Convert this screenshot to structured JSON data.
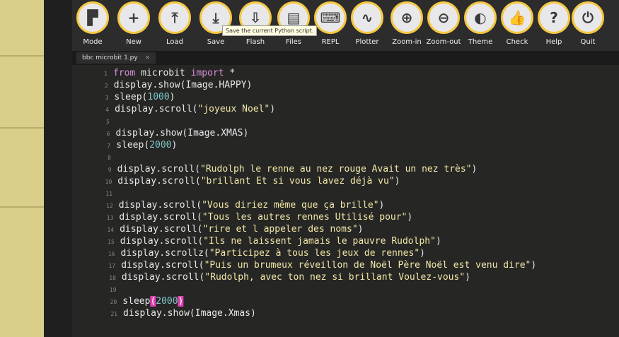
{
  "toolbar": {
    "buttons": [
      {
        "label": "Mode",
        "glyph": "▛"
      },
      {
        "label": "New",
        "glyph": "+"
      },
      {
        "label": "Load",
        "glyph": "⤒"
      },
      {
        "label": "Save",
        "glyph": "⤓"
      },
      {
        "label": "Flash",
        "glyph": "⇩"
      },
      {
        "label": "Files",
        "glyph": "▤"
      },
      {
        "label": "REPL",
        "glyph": "⌨"
      },
      {
        "label": "Plotter",
        "glyph": "∿"
      },
      {
        "label": "Zoom-in",
        "glyph": "⊕"
      },
      {
        "label": "Zoom-out",
        "glyph": "⊖"
      },
      {
        "label": "Theme",
        "glyph": "◐"
      },
      {
        "label": "Check",
        "glyph": "👍"
      },
      {
        "label": "Help",
        "glyph": "?"
      },
      {
        "label": "Quit",
        "glyph": "⏻"
      }
    ],
    "tooltip": "Save the current Python script."
  },
  "tab": {
    "label": "bbc microbit 1.py",
    "close": "×"
  },
  "code_lines": [
    {
      "n": "1",
      "parts": [
        {
          "t": "from ",
          "c": "kw"
        },
        {
          "t": "microbit ",
          "c": ""
        },
        {
          "t": "import",
          "c": "kw"
        },
        {
          "t": " *",
          "c": ""
        }
      ]
    },
    {
      "n": "2",
      "parts": [
        {
          "t": "display.show(Image.HAPPY)",
          "c": ""
        }
      ]
    },
    {
      "n": "3",
      "parts": [
        {
          "t": "sleep(",
          "c": ""
        },
        {
          "t": "1000",
          "c": "num"
        },
        {
          "t": ")",
          "c": ""
        }
      ]
    },
    {
      "n": "4",
      "parts": [
        {
          "t": "display.scroll(",
          "c": ""
        },
        {
          "t": "\"joyeux Noel\"",
          "c": "str"
        },
        {
          "t": ")",
          "c": ""
        }
      ]
    },
    {
      "n": "5",
      "parts": []
    },
    {
      "n": "6",
      "parts": [
        {
          "t": "display.show(Image.XMAS)",
          "c": ""
        }
      ]
    },
    {
      "n": "7",
      "parts": [
        {
          "t": "sleep(",
          "c": ""
        },
        {
          "t": "2000",
          "c": "num"
        },
        {
          "t": ")",
          "c": ""
        }
      ]
    },
    {
      "n": "8",
      "parts": []
    },
    {
      "n": "9",
      "parts": [
        {
          "t": "display.scroll(",
          "c": ""
        },
        {
          "t": "\"Rudolph le renne au nez rouge Avait un nez très\"",
          "c": "str"
        },
        {
          "t": ")",
          "c": ""
        }
      ]
    },
    {
      "n": "10",
      "parts": [
        {
          "t": "display.scroll(",
          "c": ""
        },
        {
          "t": "\"brillant Et si vous lavez déjà vu\"",
          "c": "str"
        },
        {
          "t": ")",
          "c": ""
        }
      ]
    },
    {
      "n": "11",
      "parts": []
    },
    {
      "n": "12",
      "parts": [
        {
          "t": "display.scroll(",
          "c": ""
        },
        {
          "t": "\"Vous diriez même que ça brille\"",
          "c": "str"
        },
        {
          "t": ")",
          "c": ""
        }
      ]
    },
    {
      "n": "13",
      "parts": [
        {
          "t": "display.scroll(",
          "c": ""
        },
        {
          "t": "\"Tous les autres rennes Utilisé pour\"",
          "c": "str"
        },
        {
          "t": ")",
          "c": ""
        }
      ]
    },
    {
      "n": "14",
      "parts": [
        {
          "t": "display.scroll(",
          "c": ""
        },
        {
          "t": "\"rire et l appeler des noms\"",
          "c": "str"
        },
        {
          "t": ")",
          "c": ""
        }
      ]
    },
    {
      "n": "15",
      "parts": [
        {
          "t": "display.scroll(",
          "c": ""
        },
        {
          "t": "\"Ils ne laissent jamais le pauvre Rudolph\"",
          "c": "str"
        },
        {
          "t": ")",
          "c": ""
        }
      ]
    },
    {
      "n": "16",
      "parts": [
        {
          "t": "display.scrollz(",
          "c": ""
        },
        {
          "t": "\"Participez à tous les jeux de rennes\"",
          "c": "str"
        },
        {
          "t": ")",
          "c": ""
        }
      ]
    },
    {
      "n": "17",
      "parts": [
        {
          "t": "display.scroll(",
          "c": ""
        },
        {
          "t": "\"Puis un brumeux réveillon de Noël Père Noël est venu dire\"",
          "c": "str"
        },
        {
          "t": ")",
          "c": ""
        }
      ]
    },
    {
      "n": "18",
      "parts": [
        {
          "t": "display.scroll(",
          "c": ""
        },
        {
          "t": "\"Rudolph, avec ton nez si brillant Voulez-vous\"",
          "c": "str"
        },
        {
          "t": ")",
          "c": ""
        }
      ]
    },
    {
      "n": "19",
      "parts": []
    },
    {
      "n": "20",
      "parts": [
        {
          "t": "sleep",
          "c": ""
        },
        {
          "t": "(",
          "c": "hl"
        },
        {
          "t": "2000",
          "c": "num"
        },
        {
          "t": ")",
          "c": "hl"
        }
      ]
    },
    {
      "n": "21",
      "parts": [
        {
          "t": "display.show(Image.Xmas)",
          "c": ""
        }
      ]
    }
  ]
}
